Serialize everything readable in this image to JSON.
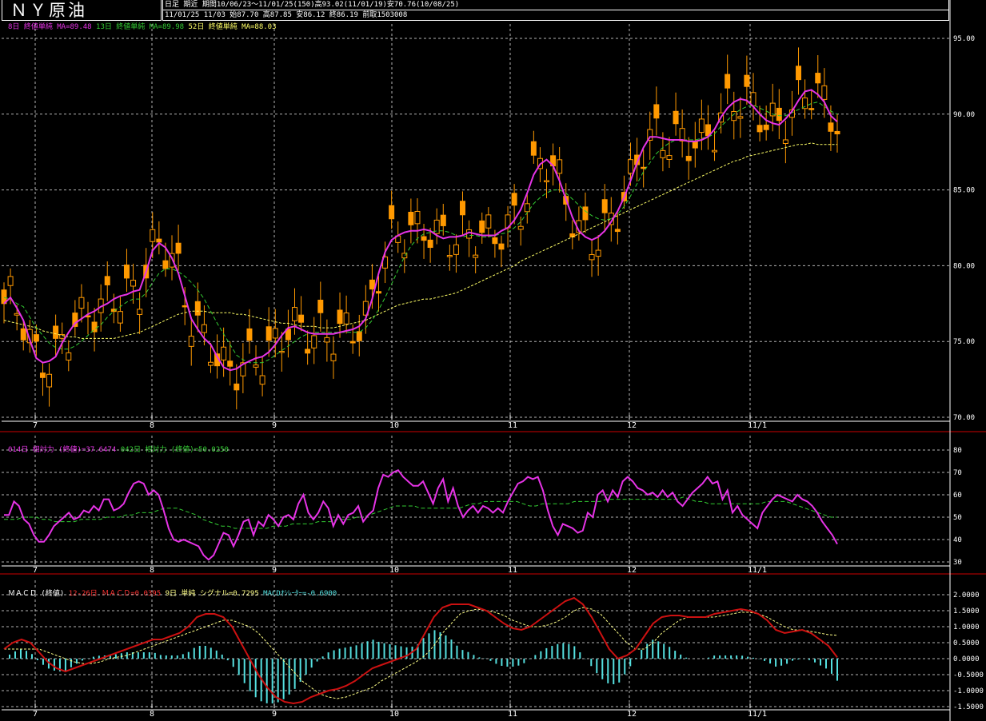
{
  "header": {
    "title": "ＮＹ原油",
    "line1": "日足 期近 期間10/06/23〜11/01/25(150)高93.02(11/01/19)安70.76(10/08/25)",
    "line2": "11/01/25 11/03 始87.70 高87.85 安86.12 終86.19 前取1503008"
  },
  "legends": {
    "main_ma8": "8日 終値単純 MA=89.48",
    "main_ma13": "13日 終値単純 MA=89.98",
    "main_ma52": "52日 終値単純 MA=88.03",
    "rsi14": "014日 相対力 (終値)=37.6474",
    "rsi42": "042日 相対力 (終値)=50.0250",
    "macd_label": "ＭＡＣＤ (終値)",
    "macd_line": "12-26日 ＭＡＣＤ=0.0395",
    "macd_signal": "9日 単純 シグナル=0.7295",
    "macd_osc": "MACDｵｼﾚｰﾀｰ=-0.6900"
  },
  "colors": {
    "candle": "#ff9900",
    "ma8": "#e633e6",
    "ma13": "#33cc33",
    "ma52": "#ffff66",
    "rsi14": "#e633e6",
    "rsi42": "#33cc33",
    "macd": "#cc1111",
    "signal": "#ffff88",
    "osc": "#55e0e0",
    "divider": "#cc0000",
    "grid": "#ffffff"
  },
  "chart_data": [
    {
      "type": "candlestick",
      "panel": "price",
      "x_labels": [
        "7",
        "8",
        "9",
        "10",
        "11",
        "12",
        "11/1"
      ],
      "y_ticks": [
        "95.00",
        "90.00",
        "85.00",
        "80.00",
        "75.00",
        "70.00"
      ],
      "ylim": [
        70,
        95
      ],
      "grid": true,
      "series": [
        {
          "name": "8日 終値単純",
          "values": [
            77.5,
            77.9,
            77.2,
            76.4,
            75.1,
            73.9,
            73.6,
            73.7,
            74.0,
            74.9,
            75.6,
            76.2,
            76.5,
            76.8,
            77.0,
            77.3,
            77.5,
            77.8,
            78.0,
            78.1,
            78.3,
            78.4,
            79.6,
            81.0,
            81.5,
            81.2,
            80.5,
            79.5,
            78.0,
            76.5,
            75.8,
            75.2,
            74.8,
            74.0,
            73.3,
            73.1,
            73.2,
            73.5,
            73.7,
            73.9,
            74.0,
            74.3,
            74.8,
            75.4,
            75.9,
            76.0,
            75.8,
            75.6,
            75.5,
            75.5,
            75.5,
            75.5,
            75.6,
            75.7,
            75.8,
            76.0,
            76.5,
            77.8,
            79.5,
            80.9,
            81.7,
            82.0,
            82.2,
            82.3,
            82.3,
            82.4,
            82.3,
            82.0,
            81.8,
            81.9,
            81.9,
            82.0,
            82.2,
            82.1,
            82.0,
            82.0,
            82.0,
            82.3,
            82.5,
            83.0,
            83.7,
            84.8,
            86.0,
            86.7,
            87.0,
            86.6,
            85.6,
            84.4,
            83.2,
            82.3,
            81.9,
            81.7,
            81.9,
            82.3,
            82.9,
            83.6,
            84.5,
            85.6,
            86.8,
            87.8,
            88.5,
            88.5,
            88.4,
            88.3,
            88.3,
            88.3,
            88.2,
            88.2,
            88.3,
            88.5,
            89.0,
            89.8,
            90.4,
            90.8,
            91.0,
            90.9,
            90.5,
            90.0,
            89.6,
            89.4,
            89.3,
            89.7,
            90.2,
            90.9,
            91.5,
            91.6,
            91.3,
            90.8,
            89.9,
            89.5
          ]
        },
        {
          "name": "13日 終値単純",
          "values": [
            77.9,
            77.8,
            77.5,
            77.3,
            76.6,
            75.9,
            75.4,
            74.9,
            74.6,
            74.5,
            74.5,
            74.7,
            75.0,
            75.4,
            75.8,
            76.1,
            76.6,
            77.0,
            77.3,
            77.6,
            77.8,
            77.8,
            78.2,
            78.9,
            79.5,
            79.8,
            79.8,
            79.6,
            79.3,
            78.9,
            78.4,
            77.8,
            77.0,
            76.2,
            75.5,
            74.8,
            74.1,
            73.8,
            73.6,
            73.6,
            73.6,
            73.8,
            74.1,
            74.4,
            74.7,
            75.0,
            75.3,
            75.5,
            75.6,
            75.6,
            75.6,
            75.6,
            75.6,
            75.6,
            75.6,
            75.6,
            75.9,
            76.4,
            77.1,
            77.9,
            78.8,
            79.7,
            80.6,
            81.3,
            81.8,
            82.1,
            82.2,
            82.3,
            82.3,
            82.2,
            82.0,
            81.9,
            82.0,
            82.0,
            81.9,
            81.9,
            82.0,
            82.1,
            82.2,
            82.5,
            82.9,
            83.5,
            84.1,
            84.5,
            84.8,
            85.0,
            85.0,
            84.8,
            84.4,
            84.0,
            83.6,
            83.3,
            83.1,
            83.0,
            83.1,
            83.4,
            83.9,
            84.6,
            85.4,
            86.2,
            86.8,
            87.4,
            87.8,
            88.1,
            88.3,
            88.3,
            88.3,
            88.3,
            88.4,
            88.5,
            88.7,
            89.2,
            89.6,
            90.0,
            90.3,
            90.5,
            90.6,
            90.4,
            90.2,
            90.0,
            89.9,
            89.9,
            90.1,
            90.3,
            90.5,
            90.7,
            90.8,
            90.5,
            90.2,
            90.0
          ]
        },
        {
          "name": "52日 終値単純",
          "values": [
            76.4,
            76.3,
            76.2,
            76.1,
            76.0,
            75.9,
            75.7,
            75.6,
            75.5,
            75.4,
            75.3,
            75.3,
            75.2,
            75.2,
            75.2,
            75.2,
            75.2,
            75.2,
            75.3,
            75.4,
            75.5,
            75.6,
            75.8,
            76.0,
            76.2,
            76.4,
            76.6,
            76.8,
            76.9,
            77.0,
            77.0,
            77.0,
            76.9,
            76.9,
            76.9,
            76.9,
            76.8,
            76.8,
            76.7,
            76.6,
            76.5,
            76.4,
            76.3,
            76.2,
            76.2,
            76.1,
            76.0,
            76.0,
            76.0,
            75.9,
            75.9,
            75.9,
            76.0,
            76.1,
            76.2,
            76.3,
            76.4,
            76.6,
            76.8,
            77.0,
            77.2,
            77.4,
            77.5,
            77.6,
            77.7,
            77.8,
            77.8,
            77.9,
            78.0,
            78.1,
            78.2,
            78.4,
            78.6,
            78.8,
            79.0,
            79.2,
            79.4,
            79.6,
            79.8,
            80.0,
            80.3,
            80.5,
            80.7,
            80.9,
            81.1,
            81.3,
            81.5,
            81.7,
            81.9,
            82.1,
            82.3,
            82.5,
            82.7,
            82.9,
            83.1,
            83.3,
            83.5,
            83.7,
            83.9,
            84.1,
            84.3,
            84.5,
            84.7,
            84.9,
            85.1,
            85.3,
            85.5,
            85.7,
            85.9,
            86.1,
            86.3,
            86.5,
            86.7,
            86.9,
            87.0,
            87.2,
            87.3,
            87.4,
            87.5,
            87.6,
            87.7,
            87.8,
            87.9,
            88.0,
            88.0,
            88.1,
            88.0,
            88.0,
            88.0,
            88.0
          ]
        }
      ]
    },
    {
      "type": "line",
      "panel": "rsi",
      "y_ticks": [
        "80",
        "70",
        "60",
        "50",
        "40",
        "30"
      ],
      "ylim": [
        30,
        80
      ],
      "series": [
        {
          "name": "014日 相対力",
          "values": [
            51,
            51,
            57,
            55,
            49,
            47,
            42,
            39,
            39,
            42,
            46,
            48,
            50,
            52,
            49,
            50,
            53,
            52,
            55,
            53,
            58,
            58,
            53,
            54,
            56,
            61,
            65,
            66,
            65,
            60,
            62,
            60,
            53,
            45,
            40,
            39,
            40,
            39,
            38,
            37,
            33,
            31,
            33,
            38,
            43,
            42,
            37,
            42,
            48,
            49,
            42,
            48,
            46,
            51,
            49,
            46,
            50,
            51,
            49,
            56,
            60,
            52,
            49,
            52,
            57,
            54,
            46,
            51,
            47,
            51,
            52,
            55,
            48,
            51,
            53,
            63,
            69,
            68,
            70,
            71,
            68,
            66,
            64,
            64,
            66,
            61,
            56,
            63,
            67,
            57,
            63,
            55,
            50,
            53,
            55,
            52,
            55,
            54,
            52,
            54,
            52,
            57,
            61,
            65,
            66,
            68,
            67,
            68,
            62,
            53,
            46,
            42,
            47,
            46,
            45,
            43,
            44,
            52,
            50,
            60,
            62,
            57,
            62,
            59,
            66,
            68,
            66,
            63,
            62,
            60,
            61,
            59,
            62,
            59,
            61,
            57,
            55,
            58,
            61,
            63,
            65,
            68,
            65,
            66,
            58,
            62,
            52,
            55,
            51,
            49,
            47,
            45,
            52,
            55,
            58,
            60,
            59,
            58,
            57,
            60,
            58,
            57,
            55,
            52,
            48,
            45,
            42,
            38
          ]
        },
        {
          "name": "042日 相対力",
          "values": [
            49,
            49,
            49,
            50,
            50,
            50,
            49,
            49,
            48,
            48,
            48,
            48,
            49,
            49,
            49,
            49,
            50,
            50,
            50,
            51,
            51,
            52,
            52,
            52,
            53,
            54,
            54,
            54,
            53,
            52,
            51,
            49,
            48,
            47,
            46,
            46,
            45,
            45,
            45,
            45,
            45,
            45,
            46,
            46,
            46,
            47,
            47,
            47,
            47,
            48,
            48,
            48,
            49,
            49,
            49,
            50,
            50,
            51,
            52,
            53,
            54,
            55,
            55,
            55,
            55,
            54,
            54,
            54,
            54,
            54,
            54,
            54,
            55,
            56,
            56,
            57,
            57,
            57,
            57,
            57,
            57,
            56,
            55,
            55,
            56,
            56,
            56,
            56,
            56,
            57,
            57,
            57,
            57,
            57,
            58,
            58,
            58,
            58,
            58,
            58,
            58,
            58,
            58,
            58,
            58,
            58,
            59,
            58,
            57,
            57,
            56,
            56,
            56,
            56,
            56,
            56,
            56,
            56,
            56,
            57,
            57,
            57,
            57,
            56,
            55,
            54,
            53,
            52,
            51,
            50,
            50
          ]
        }
      ]
    },
    {
      "type": "line",
      "panel": "macd",
      "y_ticks": [
        "2.0000",
        "1.5000",
        "1.0000",
        "0.5000",
        "0.0000",
        "-0.5000",
        "-1.0000",
        "-1.5000"
      ],
      "ylim": [
        -1.5,
        2.0
      ],
      "series": [
        {
          "name": "12-26日 ＭＡＣＤ",
          "values": [
            0.3,
            0.5,
            0.6,
            0.5,
            0.2,
            -0.1,
            -0.3,
            -0.4,
            -0.3,
            -0.2,
            -0.1,
            0.0,
            0.1,
            0.2,
            0.3,
            0.4,
            0.5,
            0.6,
            0.6,
            0.7,
            0.8,
            1.0,
            1.3,
            1.4,
            1.4,
            1.3,
            1.0,
            0.5,
            0.0,
            -0.5,
            -0.9,
            -1.2,
            -1.35,
            -1.4,
            -1.35,
            -1.2,
            -1.1,
            -1.0,
            -0.95,
            -0.85,
            -0.7,
            -0.5,
            -0.3,
            -0.2,
            -0.1,
            0.0,
            0.1,
            0.3,
            0.8,
            1.3,
            1.6,
            1.7,
            1.7,
            1.7,
            1.6,
            1.5,
            1.3,
            1.1,
            0.95,
            0.9,
            1.0,
            1.2,
            1.4,
            1.6,
            1.8,
            1.9,
            1.7,
            1.3,
            0.8,
            0.3,
            0.0,
            0.1,
            0.3,
            0.7,
            1.1,
            1.3,
            1.35,
            1.35,
            1.3,
            1.3,
            1.3,
            1.4,
            1.45,
            1.5,
            1.55,
            1.5,
            1.4,
            1.2,
            0.9,
            0.8,
            0.85,
            0.9,
            0.8,
            0.6,
            0.4,
            0.04
          ]
        },
        {
          "name": "9日 単純 シグナル",
          "values": [
            0.3,
            0.3,
            0.3,
            0.3,
            0.3,
            0.2,
            0.1,
            0.0,
            -0.1,
            -0.15,
            -0.15,
            -0.1,
            0.0,
            0.05,
            0.1,
            0.2,
            0.3,
            0.4,
            0.5,
            0.6,
            0.7,
            0.8,
            0.9,
            1.0,
            1.1,
            1.2,
            1.2,
            1.1,
            1.0,
            0.8,
            0.5,
            0.2,
            -0.1,
            -0.4,
            -0.7,
            -0.9,
            -1.1,
            -1.2,
            -1.25,
            -1.2,
            -1.1,
            -1.0,
            -0.9,
            -0.7,
            -0.55,
            -0.4,
            -0.25,
            -0.1,
            0.1,
            0.4,
            0.8,
            1.1,
            1.4,
            1.5,
            1.55,
            1.5,
            1.45,
            1.35,
            1.2,
            1.1,
            1.0,
            1.0,
            1.05,
            1.15,
            1.3,
            1.5,
            1.6,
            1.55,
            1.4,
            1.1,
            0.8,
            0.5,
            0.3,
            0.3,
            0.5,
            0.8,
            1.0,
            1.2,
            1.3,
            1.3,
            1.3,
            1.3,
            1.35,
            1.4,
            1.45,
            1.45,
            1.4,
            1.3,
            1.15,
            1.0,
            0.9,
            0.9,
            0.85,
            0.8,
            0.75,
            0.73
          ]
        }
      ]
    }
  ]
}
